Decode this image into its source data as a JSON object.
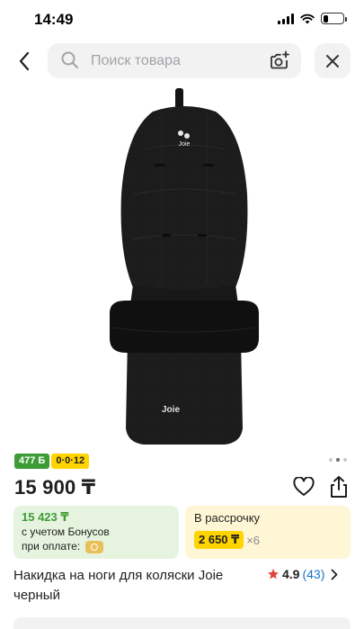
{
  "status_bar": {
    "time": "14:49",
    "battery_level": 0.28
  },
  "search": {
    "placeholder": "Поиск товара"
  },
  "icons": {
    "back": "chevron-left-icon",
    "search": "search-icon",
    "camera": "camera-plus-icon",
    "close": "close-icon",
    "favorite": "heart-icon",
    "share": "share-icon",
    "star": "star-icon"
  },
  "gallery": {
    "dot_count": 3,
    "active_index": 1,
    "image_logo": "Joie"
  },
  "badges": [
    {
      "label": "477 Б",
      "color": "#3e9c35"
    },
    {
      "label": "0·0·12",
      "color": "#ffd400"
    }
  ],
  "product": {
    "price": "15 900 ₸",
    "title": "Накидка на ноги для коляски Joie черный"
  },
  "bonus": {
    "amount": "15 423 ₸",
    "line1": "с учетом Бонусов",
    "line2": "при оплате:"
  },
  "installment": {
    "title": "В рассрочку",
    "amount": "2 650 ₸",
    "multiplier": "×6"
  },
  "rating": {
    "value": "4.9",
    "count": "(43)"
  },
  "colors": {
    "accent_green": "#3e9c35",
    "accent_yellow": "#ffd400",
    "rating_star": "#e2443a",
    "link_blue": "#1a73c8"
  }
}
